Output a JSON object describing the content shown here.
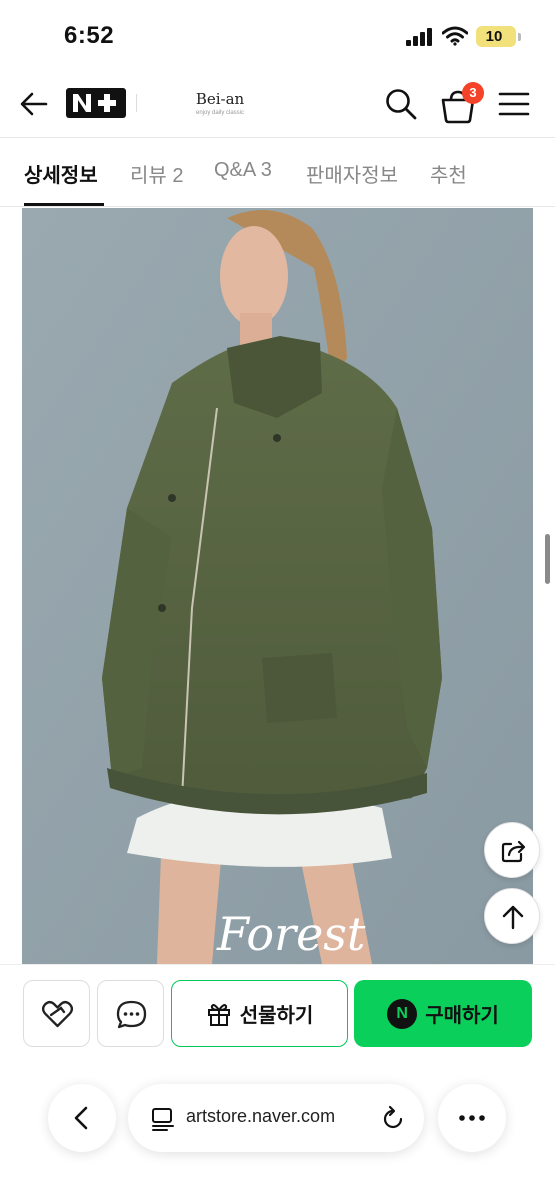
{
  "status_bar": {
    "time": "6:52",
    "battery": "10"
  },
  "header": {
    "back_icon": "arrow-left-icon",
    "platform_logo": "N+",
    "brand_name": "Bei-an",
    "brand_tagline": "enjoy daily classic",
    "cart_count": "3",
    "icons": [
      "search-icon",
      "cart-icon",
      "hamburger-menu-icon"
    ]
  },
  "tabs": [
    {
      "label": "상세정보",
      "active": true
    },
    {
      "label": "리뷰 2",
      "active": false
    },
    {
      "label": "Q&A 3",
      "active": false
    },
    {
      "label": "판매자정보",
      "active": false
    },
    {
      "label": "추천",
      "active": false
    }
  ],
  "product_image": {
    "caption": "Forest"
  },
  "floating": {
    "share_icon": "share-icon",
    "top_icon": "arrow-up-icon"
  },
  "actions": {
    "wish_icon": "heart-icon",
    "talk_icon": "chat-bubble-icon",
    "gift_label": "선물하기",
    "buy_label": "구매하기",
    "buy_badge": "N"
  },
  "browser": {
    "address": "martstore.naver.com",
    "visible_address": "artstore.naver.com"
  },
  "colors": {
    "accent_green": "#0acf5a",
    "badge_red": "#f5432a"
  }
}
